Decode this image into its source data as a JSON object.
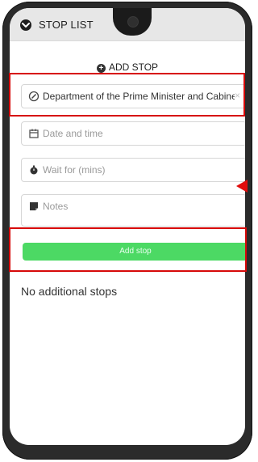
{
  "header": {
    "title": "STOP LIST"
  },
  "add_stop": {
    "label": "ADD STOP"
  },
  "fields": {
    "destination_value": "Department of the Prime Minister and Cabine",
    "datetime_placeholder": "Date and time",
    "wait_placeholder": "Wait for (mins)",
    "notes_placeholder": "Notes"
  },
  "button": {
    "add_stop_label": "Add stop"
  },
  "list": {
    "empty_text": "No additional stops"
  },
  "colors": {
    "button_green": "#4cd964",
    "highlight_red": "#d70a0a"
  },
  "icons": {
    "header": "chevron-down-icon",
    "add": "plus-circle-icon",
    "destination": "compass-icon",
    "datetime": "calendar-icon",
    "wait": "stopwatch-icon",
    "notes": "note-icon",
    "clear": "close-icon"
  }
}
